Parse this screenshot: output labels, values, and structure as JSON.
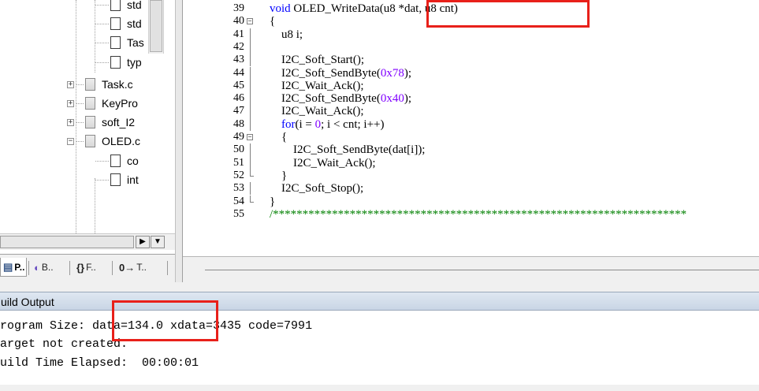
{
  "project_tree": {
    "items": [
      {
        "label": "std",
        "depth": 2,
        "expander": ""
      },
      {
        "label": "std",
        "depth": 2,
        "expander": ""
      },
      {
        "label": "Tas",
        "depth": 2,
        "expander": ""
      },
      {
        "label": "typ",
        "depth": 2,
        "expander": ""
      },
      {
        "label": "Task.c",
        "depth": 1,
        "expander": "+"
      },
      {
        "label": "KeyPro",
        "depth": 1,
        "expander": "+"
      },
      {
        "label": "soft_I2",
        "depth": 1,
        "expander": "+"
      },
      {
        "label": "OLED.c",
        "depth": 1,
        "expander": "−"
      },
      {
        "label": "co",
        "depth": 2,
        "expander": ""
      },
      {
        "label": "int",
        "depth": 2,
        "expander": ""
      }
    ]
  },
  "panel_tabs": [
    {
      "label": "P..",
      "icon": "project-icon",
      "glyph": "▤"
    },
    {
      "label": "B..",
      "icon": "books-icon",
      "glyph": "◐"
    },
    {
      "label": "F..",
      "icon": "functions-icon",
      "glyph": "{}"
    },
    {
      "label": "T..",
      "icon": "templates-icon",
      "glyph": "0→"
    }
  ],
  "editor": {
    "lines": [
      {
        "num": "39",
        "fold": "",
        "html": "<span class=\"kw\">void</span> OLED_WriteData(u8 *dat, u8 cnt)"
      },
      {
        "num": "40",
        "fold": "box-minus",
        "html": "{"
      },
      {
        "num": "41",
        "fold": "line",
        "html": "    u8 i;"
      },
      {
        "num": "42",
        "fold": "line",
        "html": ""
      },
      {
        "num": "43",
        "fold": "line",
        "html": "    I2C_Soft_Start();"
      },
      {
        "num": "44",
        "fold": "line",
        "html": "    I2C_Soft_SendByte(<span class=\"num\">0x78</span>);"
      },
      {
        "num": "45",
        "fold": "line",
        "html": "    I2C_Wait_Ack();"
      },
      {
        "num": "46",
        "fold": "line",
        "html": "    I2C_Soft_SendByte(<span class=\"num\">0x40</span>);"
      },
      {
        "num": "47",
        "fold": "line",
        "html": "    I2C_Wait_Ack();"
      },
      {
        "num": "48",
        "fold": "line",
        "html": "    <span class=\"kw\">for</span>(i = <span class=\"num\">0</span>; i &lt; cnt; i++)"
      },
      {
        "num": "49",
        "fold": "box-minus",
        "html": "    {"
      },
      {
        "num": "50",
        "fold": "line",
        "html": "        I2C_Soft_SendByte(dat[i]);"
      },
      {
        "num": "51",
        "fold": "line",
        "html": "        I2C_Wait_Ack();"
      },
      {
        "num": "52",
        "fold": "end",
        "html": "    }"
      },
      {
        "num": "53",
        "fold": "line",
        "html": "    I2C_Soft_Stop();"
      },
      {
        "num": "54",
        "fold": "end",
        "html": "}"
      },
      {
        "num": "55",
        "fold": "",
        "html": "<span class=\"cmt\">/**********************************************************************</span>"
      }
    ]
  },
  "build_output": {
    "title": "uild Output",
    "lines": [
      "rogram Size: data=134.0 xdata=3435 code=7991",
      "arget not created.",
      "uild Time Elapsed:  00:00:01"
    ]
  },
  "annotations": {
    "highlight_color": "#e8201a"
  }
}
